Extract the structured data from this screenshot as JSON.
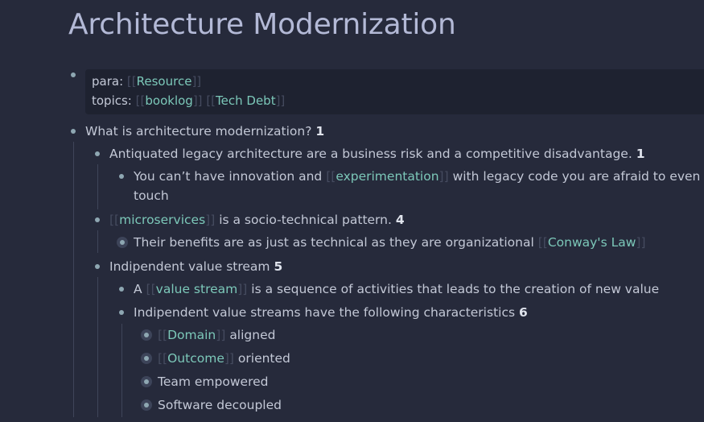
{
  "page": {
    "title": "Architecture Modernization"
  },
  "properties": {
    "para_key": "para:",
    "para_link": "Resource",
    "topics_key": "topics:",
    "topics_links": [
      "booklog",
      "Tech Debt"
    ]
  },
  "blocks": {
    "q": {
      "text": "What is architecture modernization?",
      "ref": "1"
    },
    "b1": {
      "text": "Antiquated legacy architecture are a business risk and a competitive disadvantage.",
      "ref": "1"
    },
    "b1a": {
      "pre": "You can’t have innovation and",
      "link": "experimentation",
      "post": "with legacy code you are afraid to even",
      "cont": "touch"
    },
    "b2": {
      "link": "microservices",
      "post": "is a socio-technical pattern.",
      "ref": "4"
    },
    "b2a": {
      "pre": "Their benefits are as just as technical as they are organizational",
      "link": "Conway's Law"
    },
    "b3": {
      "text": "Indipendent value stream",
      "ref": "5"
    },
    "b3a": {
      "pre": "A",
      "link": "value stream",
      "post": "is a sequence of activities that leads to the creation of new value"
    },
    "b3b": {
      "text": "Indipendent value streams have the following characteristics",
      "ref": "6"
    },
    "c1": {
      "link": "Domain",
      "post": "aligned"
    },
    "c2": {
      "link": "Outcome",
      "post": "oriented"
    },
    "c3": {
      "text": "Team empowered"
    },
    "c4": {
      "text": "Software decoupled"
    }
  }
}
